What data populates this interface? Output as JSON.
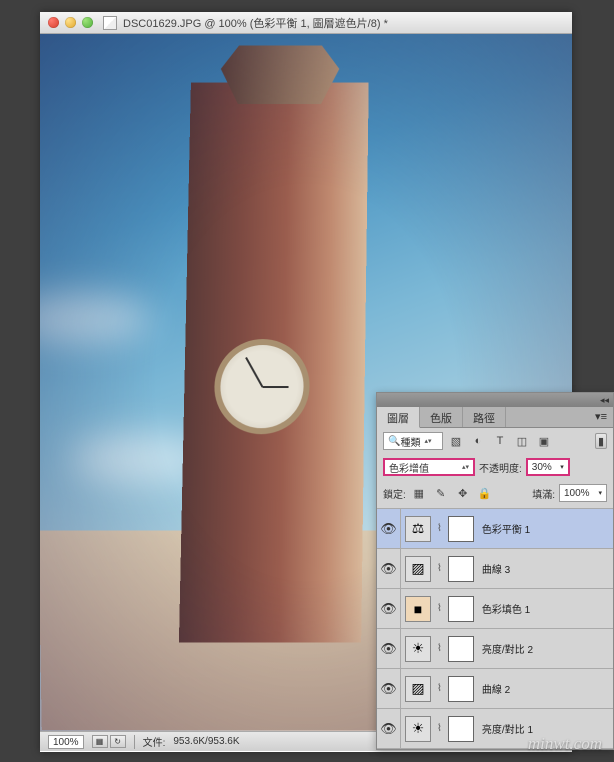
{
  "window": {
    "title": "DSC01629.JPG @ 100% (色彩平衡 1, 圖層遮色片/8) *"
  },
  "statusbar": {
    "zoom": "100%",
    "file_label": "文件:",
    "file_size": "953.6K/953.6K"
  },
  "panel": {
    "tabs": [
      "圖層",
      "色版",
      "路徑"
    ],
    "search_label": "種類",
    "blend_mode": "色彩增值",
    "opacity_label": "不透明度:",
    "opacity_value": "30%",
    "lock_label": "鎖定:",
    "fill_label": "填滿:",
    "fill_value": "100%"
  },
  "layers": [
    {
      "icon": "⚖",
      "name": "色彩平衡 1",
      "selected": true
    },
    {
      "icon": "▨",
      "name": "曲線 3",
      "selected": false
    },
    {
      "icon": "■",
      "name": "色彩填色 1",
      "selected": false,
      "colorfill": true
    },
    {
      "icon": "☀",
      "name": "亮度/對比 2",
      "selected": false
    },
    {
      "icon": "▨",
      "name": "曲線 2",
      "selected": false
    },
    {
      "icon": "☀",
      "name": "亮度/對比 1",
      "selected": false
    }
  ],
  "watermark": "minwt.com"
}
